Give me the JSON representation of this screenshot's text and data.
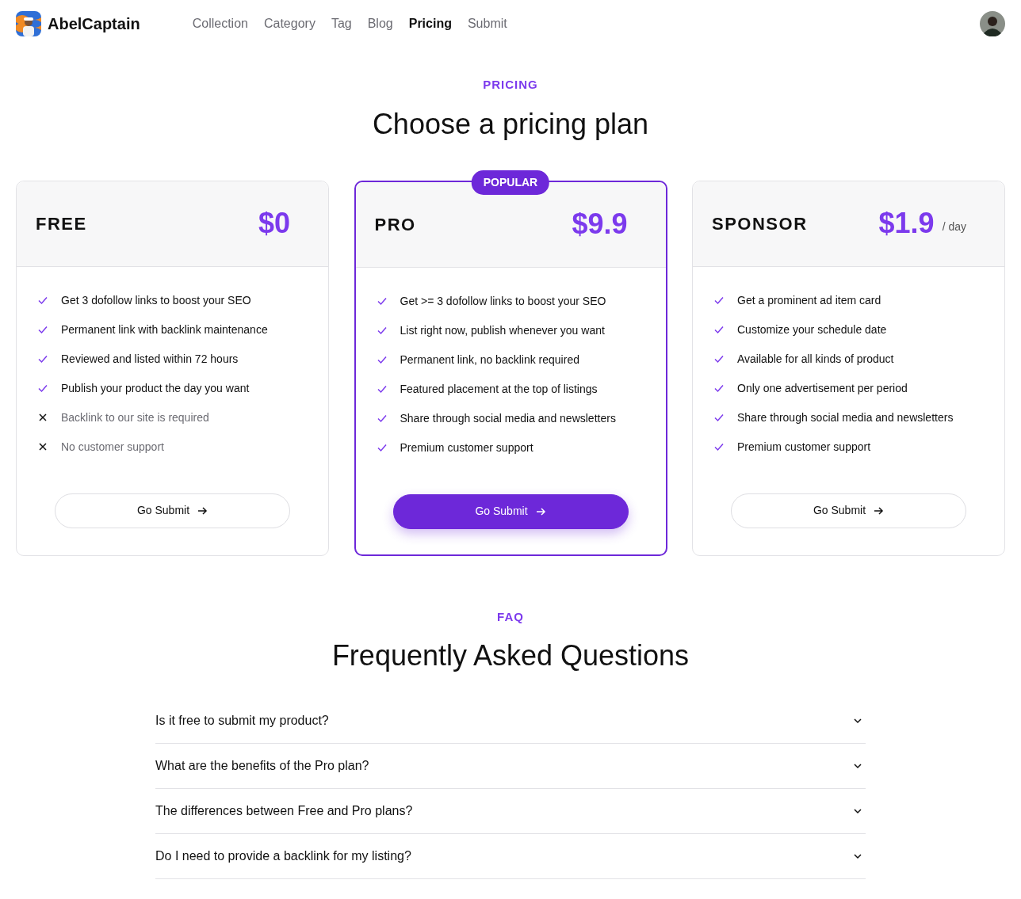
{
  "brand": {
    "name": "AbelCaptain"
  },
  "nav": [
    {
      "label": "Collection",
      "selected": false
    },
    {
      "label": "Category",
      "selected": false
    },
    {
      "label": "Tag",
      "selected": false
    },
    {
      "label": "Blog",
      "selected": false
    },
    {
      "label": "Pricing",
      "selected": true
    },
    {
      "label": "Submit",
      "selected": false
    }
  ],
  "pricing": {
    "eyebrow": "PRICING",
    "title": "Choose a pricing plan"
  },
  "plans": [
    {
      "name": "FREE",
      "price": "$0",
      "featured": false,
      "features": [
        {
          "text": "Get 3 dofollow links to boost your SEO",
          "included": true
        },
        {
          "text": "Permanent link with backlink maintenance",
          "included": true
        },
        {
          "text": "Reviewed and listed within 72 hours",
          "included": true
        },
        {
          "text": "Publish your product the day you want",
          "included": true
        },
        {
          "text": "Backlink to our site is required",
          "included": false
        },
        {
          "text": "No customer support",
          "included": false
        }
      ],
      "button": "Go Submit"
    },
    {
      "name": "PRO",
      "price": "$9.9",
      "featured": true,
      "badge": "POPULAR",
      "features": [
        {
          "text": "Get >= 3 dofollow links to boost your SEO",
          "included": true
        },
        {
          "text": "List right now, publish whenever you want",
          "included": true
        },
        {
          "text": "Permanent link, no backlink required",
          "included": true
        },
        {
          "text": "Featured placement at the top of listings",
          "included": true
        },
        {
          "text": "Share through social media and newsletters",
          "included": true
        },
        {
          "text": "Premium customer support",
          "included": true
        }
      ],
      "button": "Go Submit"
    },
    {
      "name": "SPONSOR",
      "price": "$1.9",
      "period": "/ day",
      "featured": false,
      "features": [
        {
          "text": "Get a prominent ad item card",
          "included": true
        },
        {
          "text": "Customize your schedule date",
          "included": true
        },
        {
          "text": "Available for all kinds of product",
          "included": true
        },
        {
          "text": "Only one advertisement per period",
          "included": true
        },
        {
          "text": "Share through social media and newsletters",
          "included": true
        },
        {
          "text": "Premium customer support",
          "included": true
        }
      ],
      "button": "Go Submit"
    }
  ],
  "faq": {
    "eyebrow": "FAQ",
    "title": "Frequently Asked Questions",
    "items": [
      {
        "question": "Is it free to submit my product?",
        "expanded": false
      },
      {
        "question": "What are the benefits of the Pro plan?",
        "expanded": false
      },
      {
        "question": "The differences between Free and Pro plans?",
        "expanded": false
      },
      {
        "question": "Do I need to provide a backlink for my listing?",
        "expanded": false
      }
    ]
  }
}
